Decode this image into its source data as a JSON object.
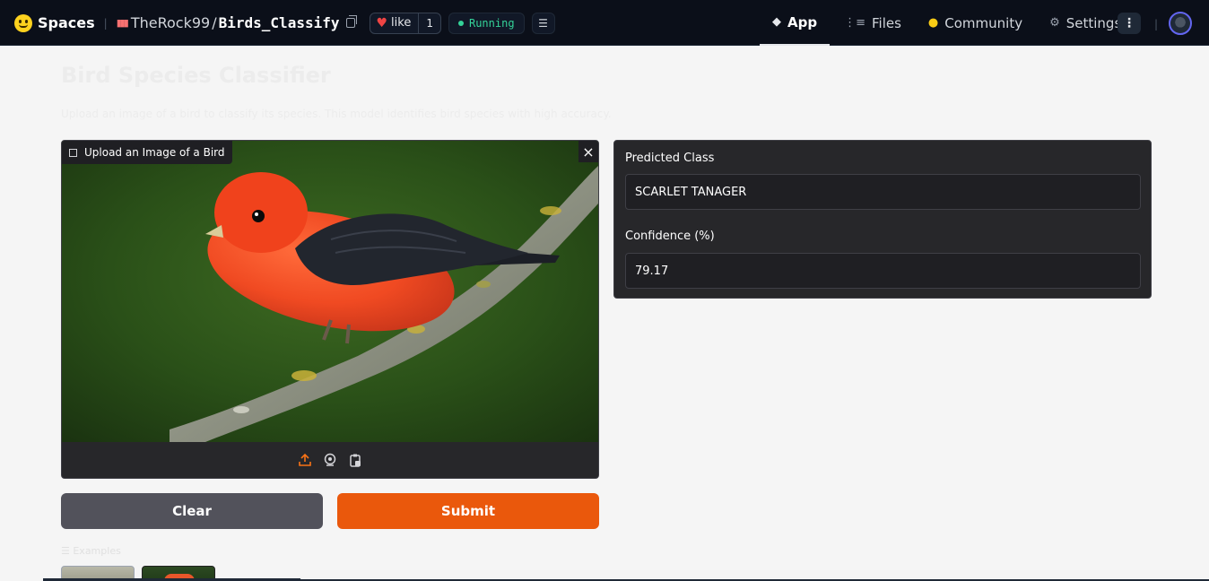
{
  "header": {
    "spaces_label": "Spaces",
    "owner": "TheRock99",
    "separator": "/",
    "repo": "Birds_Classify",
    "like_label": "like",
    "like_count": "1",
    "status": "Running",
    "nav": {
      "app": "App",
      "files": "Files",
      "community": "Community",
      "settings": "Settings"
    }
  },
  "main": {
    "title": "Bird Species Classifier",
    "description": "Upload an image of a bird to classify its species. This model identifies bird species with high accuracy.",
    "upload": {
      "label": "Upload an Image of a Bird",
      "close": "×"
    },
    "buttons": {
      "clear": "Clear",
      "submit": "Submit"
    },
    "examples_label": "☰ Examples"
  },
  "results": {
    "predicted_label": "Predicted Class",
    "predicted_value": "SCARLET TANAGER",
    "confidence_label": "Confidence (%)",
    "confidence_value": "79.17"
  },
  "colors": {
    "topbar_bg": "#0b0f19",
    "panel_bg": "#27272a",
    "submit_orange": "#ea580c",
    "clear_gray": "#52525b",
    "running_green": "#34d399"
  },
  "icons": [
    "hf-logo-icon",
    "copy-icon",
    "heart-icon",
    "menu-icon",
    "app-cube-icon",
    "files-icon",
    "community-icon",
    "gear-icon",
    "more-vertical-icon",
    "image-icon",
    "close-icon",
    "upload-icon",
    "webcam-icon",
    "clipboard-icon"
  ]
}
